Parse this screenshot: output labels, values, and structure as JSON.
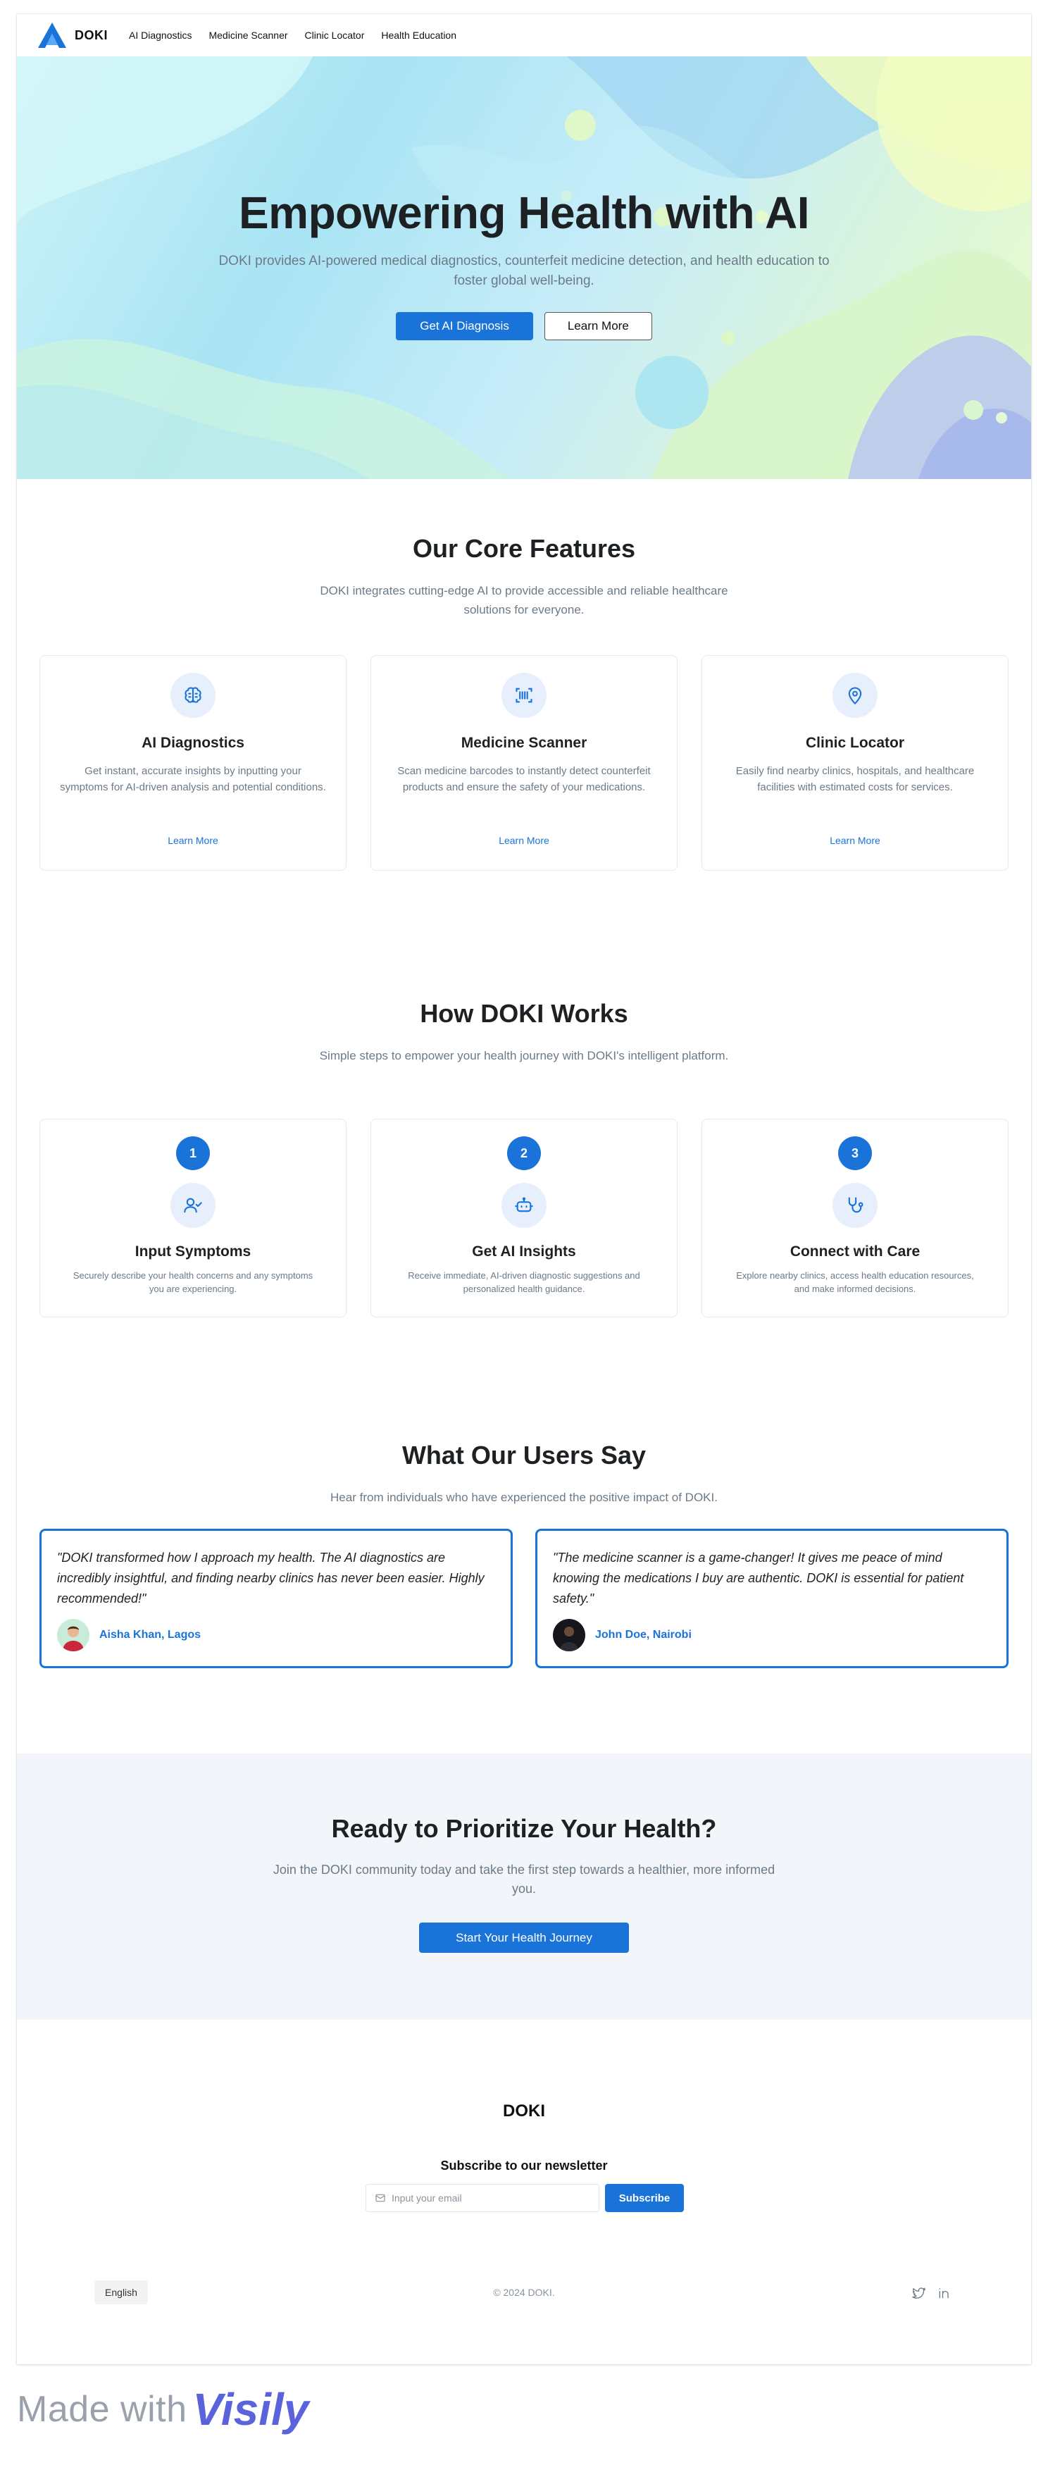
{
  "nav": {
    "brand": "DOKI",
    "links": [
      "AI Diagnostics",
      "Medicine Scanner",
      "Clinic Locator",
      "Health Education"
    ]
  },
  "hero": {
    "title": "Empowering Health with AI",
    "subtitle": "DOKI provides AI-powered medical diagnostics, counterfeit medicine detection, and health education to foster global well-being.",
    "primary_button": "Get AI Diagnosis",
    "secondary_button": "Learn More"
  },
  "features": {
    "title": "Our Core Features",
    "subtitle": "DOKI integrates cutting-edge AI to provide accessible and reliable healthcare solutions for everyone.",
    "cards": [
      {
        "icon": "brain-icon",
        "title": "AI Diagnostics",
        "description": "Get instant, accurate insights by inputting your symptoms for AI-driven analysis and potential conditions.",
        "link": "Learn More"
      },
      {
        "icon": "barcode-scan-icon",
        "title": "Medicine Scanner",
        "description": "Scan medicine barcodes to instantly detect counterfeit products and ensure the safety of your medications.",
        "link": "Learn More"
      },
      {
        "icon": "map-pin-icon",
        "title": "Clinic Locator",
        "description": "Easily find nearby clinics, hospitals, and healthcare facilities with estimated costs for services.",
        "link": "Learn More"
      }
    ]
  },
  "how": {
    "title": "How DOKI Works",
    "subtitle": "Simple steps to empower your health journey with DOKI's intelligent platform.",
    "steps": [
      {
        "number": "1",
        "icon": "user-check-icon",
        "title": "Input Symptoms",
        "description": "Securely describe your health concerns and any symptoms you are experiencing."
      },
      {
        "number": "2",
        "icon": "robot-icon",
        "title": "Get AI Insights",
        "description": "Receive immediate, AI-driven diagnostic suggestions and personalized health guidance."
      },
      {
        "number": "3",
        "icon": "stethoscope-icon",
        "title": "Connect with Care",
        "description": "Explore nearby clinics, access health education resources, and make informed decisions."
      }
    ]
  },
  "testimonials": {
    "title": "What Our Users Say",
    "subtitle": "Hear from individuals who have experienced the positive impact of DOKI.",
    "items": [
      {
        "quote": "\"DOKI transformed how I approach my health. The AI diagnostics are incredibly insightful, and finding nearby clinics has never been easier. Highly recommended!\"",
        "name": "Aisha Khan, Lagos"
      },
      {
        "quote": "\"The medicine scanner is a game-changer! It gives me peace of mind knowing the medications I buy are authentic. DOKI is essential for patient safety.\"",
        "name": "John Doe, Nairobi"
      }
    ]
  },
  "cta": {
    "title": "Ready to Prioritize Your Health?",
    "subtitle": "Join the DOKI community today and take the first step towards a healthier, more informed you.",
    "button": "Start Your Health Journey"
  },
  "footer": {
    "brand": "DOKI",
    "newsletter_title": "Subscribe to our newsletter",
    "email_placeholder": "Input your email",
    "subscribe_button": "Subscribe",
    "language": "English",
    "copyright": "© 2024 DOKI."
  },
  "watermark": {
    "made_with": "Made with",
    "brand": "Visily"
  },
  "colors": {
    "accent": "#1a73d9",
    "text_dark": "#1e2124",
    "text_muted": "#6c7a87",
    "cta_bg": "#f2f6fa"
  }
}
